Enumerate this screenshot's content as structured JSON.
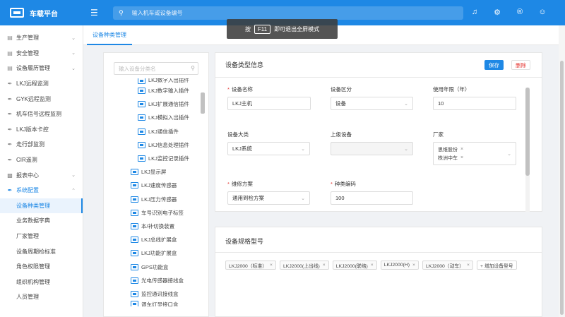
{
  "app": {
    "title": "车载平台"
  },
  "header": {
    "search_placeholder": "输入机车或设备编号",
    "icons": [
      "menu-icon",
      "search-icon",
      "bell-icon",
      "gear-icon",
      "registered-icon",
      "user-icon"
    ]
  },
  "toast": {
    "prefix": "按",
    "key": "F11",
    "suffix": "即可退出全屏模式"
  },
  "sidebar": {
    "items": [
      {
        "label": "生产管理",
        "icon": "calendar-icon",
        "arrow": "⌄"
      },
      {
        "label": "安全管理",
        "icon": "calendar-icon",
        "arrow": "⌄"
      },
      {
        "label": "设备履历管理",
        "icon": "calendar-icon",
        "arrow": "⌄"
      },
      {
        "label": "LKJ远程监测",
        "icon": "wrench-icon"
      },
      {
        "label": "GYK远程监测",
        "icon": "wrench-icon"
      },
      {
        "label": "机车信号远程监测",
        "icon": "wrench-icon"
      },
      {
        "label": "LKJ版本卡控",
        "icon": "wrench-icon"
      },
      {
        "label": "走行部监测",
        "icon": "wrench-icon"
      },
      {
        "label": "CIR遥测",
        "icon": "wrench-icon"
      },
      {
        "label": "报表中心",
        "icon": "chart-icon",
        "arrow": "⌄"
      },
      {
        "label": "系统配置",
        "icon": "wrench-icon",
        "arrow": "⌃"
      }
    ],
    "subitems": [
      {
        "label": "设备种类管理",
        "active": true
      },
      {
        "label": "业务数据字典"
      },
      {
        "label": "厂家管理"
      },
      {
        "label": "设备周期检标准"
      },
      {
        "label": "角色权限管理"
      },
      {
        "label": "组织机构管理"
      },
      {
        "label": "人员管理"
      }
    ]
  },
  "tabs": [
    {
      "label": "设备种类管理"
    }
  ],
  "tree": {
    "search_placeholder": "输入设备分类名",
    "nodes": [
      {
        "label": "LKJ数字入出插件",
        "level": 2
      },
      {
        "label": "LKJ数字输入插件",
        "level": 2
      },
      {
        "label": "LKJ扩展通信插件",
        "level": 2
      },
      {
        "label": "LKJ模拟入出插件",
        "level": 2
      },
      {
        "label": "LKJ通信插件",
        "level": 2
      },
      {
        "label": "LKJ信息处理插件",
        "level": 2
      },
      {
        "label": "LKJ监控记录插件",
        "level": 2
      },
      {
        "label": "LKJ显示屏",
        "level": 1
      },
      {
        "label": "LKJ速度传感器",
        "level": 1
      },
      {
        "label": "LKJ压力传感器",
        "level": 1
      },
      {
        "label": "车号识别电子标签",
        "level": 1
      },
      {
        "label": "本/补切换装置",
        "level": 1
      },
      {
        "label": "LKJ总线扩展盒",
        "level": 1
      },
      {
        "label": "LKJ功能扩展盒",
        "level": 1
      },
      {
        "label": "GPS功能盒",
        "level": 1
      },
      {
        "label": "光电传感器接线盒",
        "level": 1
      },
      {
        "label": "监控通讯接线盒",
        "level": 1
      },
      {
        "label": "调车灯显接口盒",
        "level": 1
      }
    ]
  },
  "device_info": {
    "title": "设备类型信息",
    "save_label": "保存",
    "delete_label": "删除",
    "fields": {
      "name": {
        "label": "设备名称",
        "value": "LKJ主机",
        "required": true
      },
      "section": {
        "label": "设备区分",
        "value": "设备"
      },
      "years": {
        "label": "使用年限（年）",
        "value": "10"
      },
      "category": {
        "label": "设备大类",
        "value": "LKJ系统"
      },
      "parent": {
        "label": "上级设备",
        "value": ""
      },
      "vendor": {
        "label": "厂家",
        "values": [
          "思维股份",
          "株洲中车"
        ]
      },
      "repair": {
        "label": "维修方案",
        "value": "通用到检方案",
        "required": true
      },
      "code": {
        "label": "种类编码",
        "value": "100",
        "required": true
      }
    }
  },
  "spec": {
    "title": "设备规格型号",
    "tags": [
      "LKJ2000（标准）",
      "LKJ2000(上出线)",
      "LKJ2000(联络)",
      "LKJ2000(H)",
      "LKJ2000（动车）"
    ],
    "add_label": "+ 增加设备型号"
  },
  "colors": {
    "primary": "#1e88e5",
    "danger": "#e53935"
  }
}
